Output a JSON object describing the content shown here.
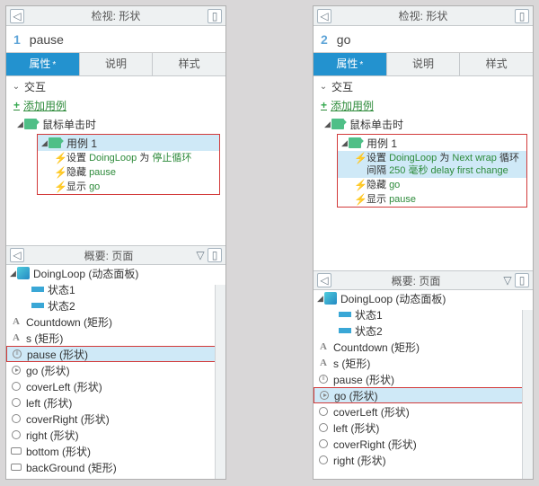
{
  "panelTitle": "检视: 形状",
  "panel1Num": "1",
  "panel1Name": "pause",
  "panel2Num": "2",
  "panel2Name": "go",
  "tabs": {
    "prop": "属性",
    "desc": "说明",
    "style": "样式",
    "dot": "*"
  },
  "section": {
    "interaction": "交互",
    "addCase": "添加用例"
  },
  "tree": {
    "mouseClick": "鼠标单击时",
    "case1": "用例 1",
    "set": "设置",
    "doingLoop": "DoingLoop",
    "to": "为",
    "stopLoop": "停止循环",
    "hide": "隐藏",
    "show": "显示",
    "pause": "pause",
    "go": "go",
    "nextWrap": "Next wrap",
    "interval": "循环间隔",
    "ms": "250 毫秒",
    "delay": "delay first change"
  },
  "outlineTitle": "概要: 页面",
  "items": {
    "doingLoop": "DoingLoop (动态面板)",
    "state1": "状态1",
    "state2": "状态2",
    "countdown": "Countdown (矩形)",
    "s": "s (矩形)",
    "pause": "pause (形状)",
    "go": "go (形状)",
    "coverLeft": "coverLeft (形状)",
    "left": "left (形状)",
    "coverRight": "coverRight (形状)",
    "right": "right (形状)",
    "bottom": "bottom (形状)",
    "backGround": "backGround (矩形)"
  }
}
